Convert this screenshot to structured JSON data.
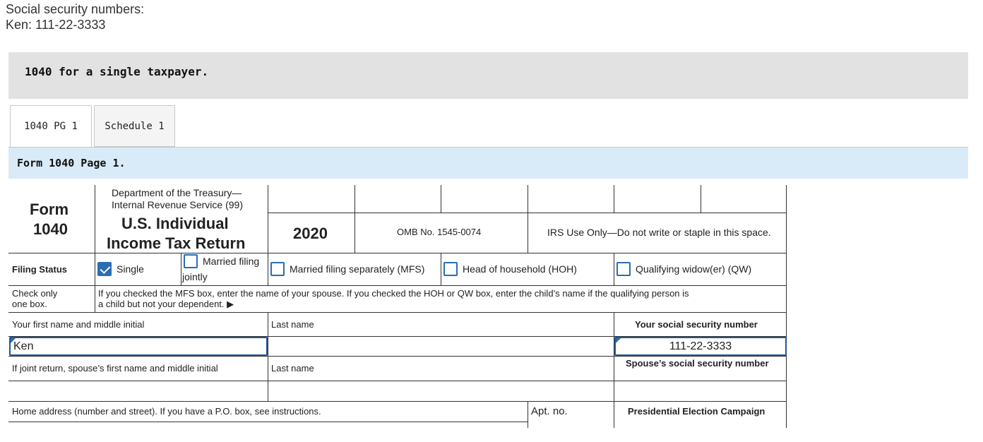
{
  "intro": {
    "line1": "Social security numbers:",
    "line2": "Ken: 111-22-3333"
  },
  "banner": {
    "title": "1040 for a single taxpayer."
  },
  "tabs": [
    {
      "label": "1040 PG 1",
      "active": true
    },
    {
      "label": "Schedule 1",
      "active": false
    }
  ],
  "section": {
    "title": "Form 1040 Page 1."
  },
  "form": {
    "form_word": "Form",
    "form_number": "1040",
    "department_line1": "Department of the Treasury—",
    "department_line2": "Internal Revenue Service (99)",
    "title_line1": "U.S. Individual",
    "title_line2": "Income Tax Return",
    "year": "2020",
    "omb": "OMB No. 1545-0074",
    "irs_use": "IRS Use Only—Do not write or staple in this space.",
    "filing_status_label": "Filing Status",
    "check_only_line1": "Check only",
    "check_only_line2": "one box.",
    "options": {
      "single": "Single",
      "mfj_line1": "Married filing",
      "mfj_line2": "jointly",
      "mfs": "Married filing separately (MFS)",
      "hoh": "Head of household (HOH)",
      "qw": "Qualifying widow(er) (QW)"
    },
    "option_checked": {
      "single": true,
      "mfj": false,
      "mfs": false,
      "hoh": false,
      "qw": false
    },
    "mfs_note_line1": "If you checked the MFS box, enter the name of your spouse. If you checked the HOH or QW box, enter the child’s name if the qualifying person is",
    "mfs_note_line2": "a child but not your dependent. ▶",
    "first_name_label": "Your first name and middle initial",
    "last_name_label": "Last name",
    "ssn_label": "Your social security number",
    "first_name_value": "Ken",
    "last_name_value": "",
    "ssn_value": "111-22-3333",
    "spouse_first_label": "If joint return, spouse’s first name and middle initial",
    "spouse_last_label": "Last name",
    "spouse_ssn_label": "Spouse’s social security number",
    "spouse_first_value": "",
    "spouse_last_value": "",
    "spouse_ssn_value": "",
    "address_label": "Home address (number and street). If you have a P.O. box, see instructions.",
    "apt_label": "Apt. no.",
    "presidential_label": "Presidential Election Campaign"
  },
  "colors": {
    "accent": "#2a6db5",
    "banner_bg": "#e2e2e2",
    "section_bg": "#d9ebf8"
  }
}
